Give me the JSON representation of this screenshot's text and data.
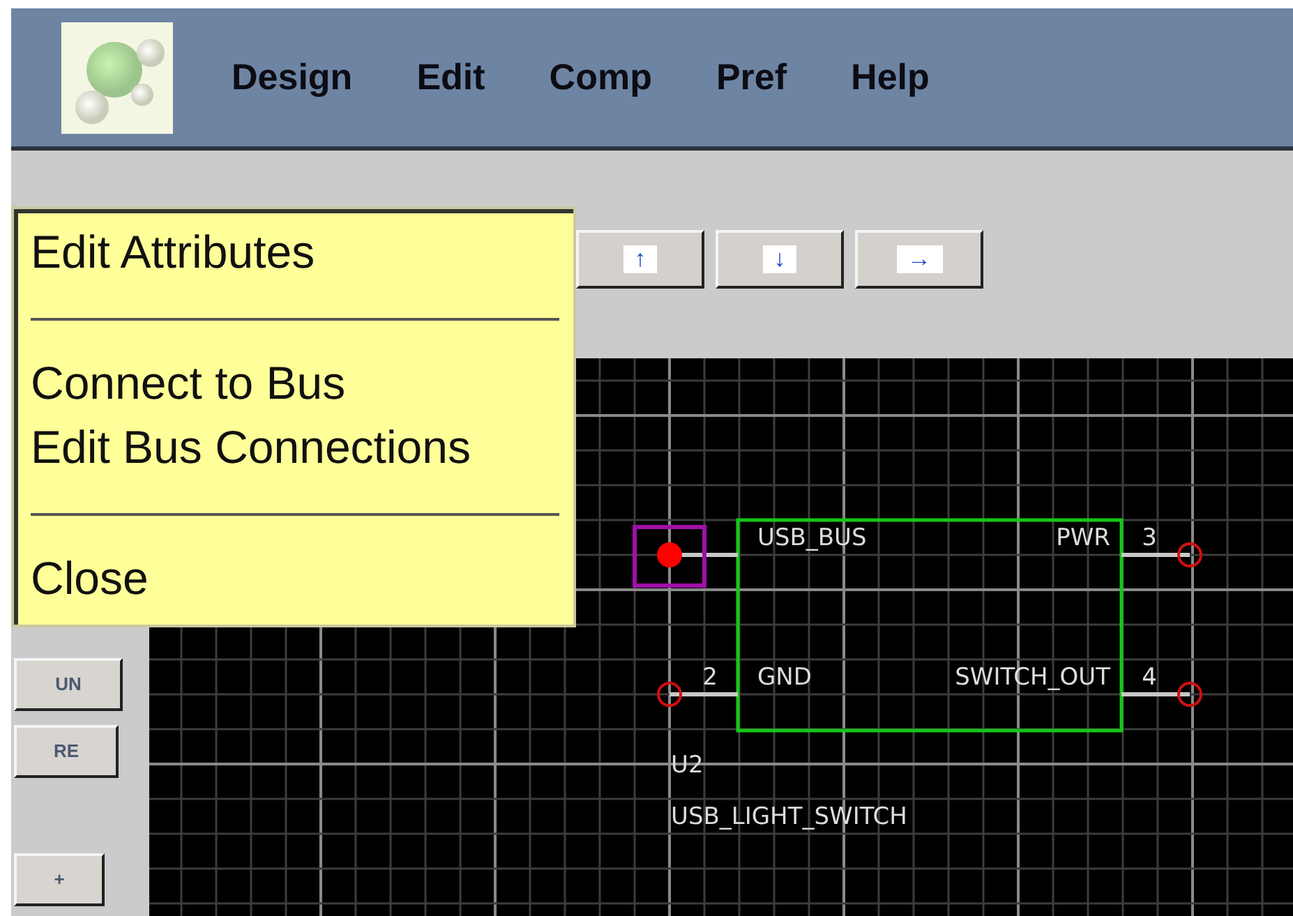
{
  "menu_bar": [
    "Design",
    "Edit",
    "Comp",
    "Pref",
    "Help"
  ],
  "toolbar_buttons": [
    "↑",
    "↓",
    "→"
  ],
  "side_buttons": [
    "UN",
    "RE",
    "+"
  ],
  "context_menu": {
    "groups": [
      [
        "Edit Attributes"
      ],
      [
        "Connect to Bus",
        "Edit Bus Connections"
      ],
      [
        "Close"
      ]
    ]
  },
  "component": {
    "reference": "U2",
    "value": "USB_LIGHT_SWITCH",
    "pin_rows": [
      {
        "left": {
          "name": "USB_BUS",
          "selected": true
        },
        "right": {
          "number": "3",
          "name": "PWR",
          "selected": false
        }
      },
      {
        "left": {
          "number": "2",
          "name": "GND",
          "selected": false
        },
        "right": {
          "number": "4",
          "name": "SWITCH_OUT",
          "selected": false
        }
      }
    ]
  }
}
